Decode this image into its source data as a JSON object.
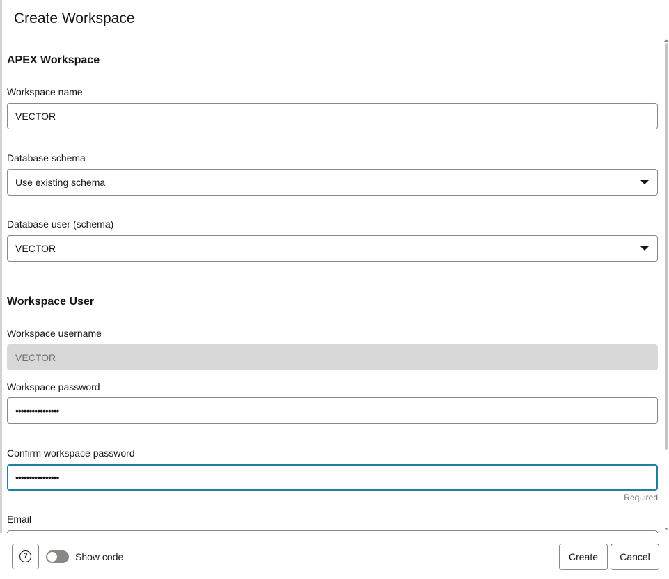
{
  "dialog": {
    "title": "Create Workspace"
  },
  "apex_section": {
    "heading": "APEX Workspace",
    "workspace_name": {
      "label": "Workspace name",
      "value": "VECTOR"
    },
    "database_schema": {
      "label": "Database schema",
      "value": "Use existing schema"
    },
    "database_user": {
      "label": "Database user (schema)",
      "value": "VECTOR"
    }
  },
  "user_section": {
    "heading": "Workspace User",
    "username": {
      "label": "Workspace username",
      "value": "VECTOR"
    },
    "password": {
      "label": "Workspace password",
      "value": "••••••••••••••••"
    },
    "confirm_password": {
      "label": "Confirm workspace password",
      "value": "••••••••••••••••",
      "hint": "Required"
    },
    "email": {
      "label": "Email",
      "value": ""
    }
  },
  "footer": {
    "help_glyph": "?",
    "show_code_label": "Show code",
    "show_code_enabled": false,
    "create_label": "Create",
    "cancel_label": "Cancel"
  },
  "colors": {
    "focus_border": "#227e9e",
    "readonly_bg": "#d8d8d8",
    "border": "#8b8883"
  }
}
